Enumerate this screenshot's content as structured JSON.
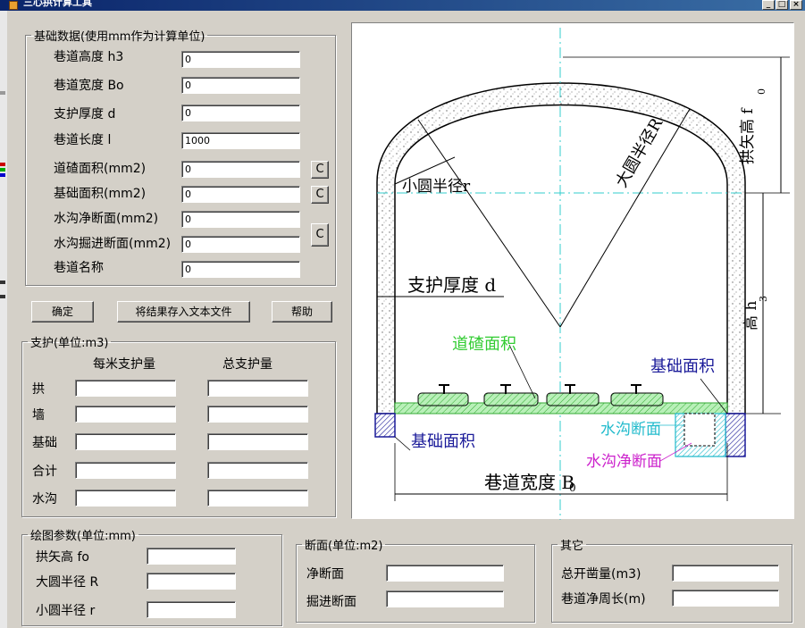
{
  "window": {
    "title": "三心拱计算工具"
  },
  "basic": {
    "legend": "基础数据(使用mm作为计算单位)",
    "fields": [
      {
        "label": "巷道高度 h3",
        "value": "0"
      },
      {
        "label": "巷道宽度 Bo",
        "value": "0"
      },
      {
        "label": "支护厚度 d",
        "value": "0"
      },
      {
        "label": "巷道长度 l",
        "value": "1000"
      },
      {
        "label": "道碴面积(mm2)",
        "value": "0"
      },
      {
        "label": "基础面积(mm2)",
        "value": "0"
      },
      {
        "label": "水沟净断面(mm2)",
        "value": "0"
      },
      {
        "label": "水沟掘进断面(mm2)",
        "value": "0"
      },
      {
        "label": "巷道名称",
        "value": "0"
      }
    ],
    "calc_button": "C"
  },
  "buttons": {
    "ok": "确定",
    "save": "将结果存入文本文件",
    "help": "帮助"
  },
  "support": {
    "legend": "支护(单位:m3)",
    "col_per_meter": "每米支护量",
    "col_total": "总支护量",
    "rows": [
      {
        "label": "拱",
        "per_meter": "",
        "total": ""
      },
      {
        "label": "墙",
        "per_meter": "",
        "total": ""
      },
      {
        "label": "基础",
        "per_meter": "",
        "total": ""
      },
      {
        "label": "合计",
        "per_meter": "",
        "total": ""
      },
      {
        "label": "水沟",
        "per_meter": "",
        "total": ""
      }
    ]
  },
  "drawing": {
    "legend": "绘图参数(单位:mm)",
    "rows": [
      {
        "label": "拱矢高 fo",
        "value": ""
      },
      {
        "label": "大圆半径 R",
        "value": ""
      },
      {
        "label": "小圆半径 r",
        "value": ""
      }
    ]
  },
  "section": {
    "legend": "断面(单位:m2)",
    "rows": [
      {
        "label": "净断面",
        "value": ""
      },
      {
        "label": "掘进断面",
        "value": ""
      }
    ]
  },
  "other": {
    "legend": "其它",
    "rows": [
      {
        "label": "总开凿量(m3)",
        "value": ""
      },
      {
        "label": "巷道净周长(m)",
        "value": ""
      }
    ]
  },
  "diagram": {
    "labels": {
      "small_radius": "小圆半径r",
      "large_radius": "大圆半径R",
      "arch_height": "拱矢高 f",
      "arch_height_sub": "0",
      "thickness": "支护厚度 d",
      "wall_height": "高 h",
      "wall_height_sub": "3",
      "ballast": "道碴面积",
      "foundation_right": "基础面积",
      "foundation_left": "基础面积",
      "ditch": "水沟断面",
      "ditch_net": "水沟净断面",
      "width": "巷道宽度 B",
      "width_sub": "0"
    },
    "colors": {
      "ballast": "#33cc33",
      "foundation": "#1a1a99",
      "ditch": "#22bbcc",
      "ditch_net": "#cc22cc",
      "centerline": "#33cccc"
    }
  }
}
